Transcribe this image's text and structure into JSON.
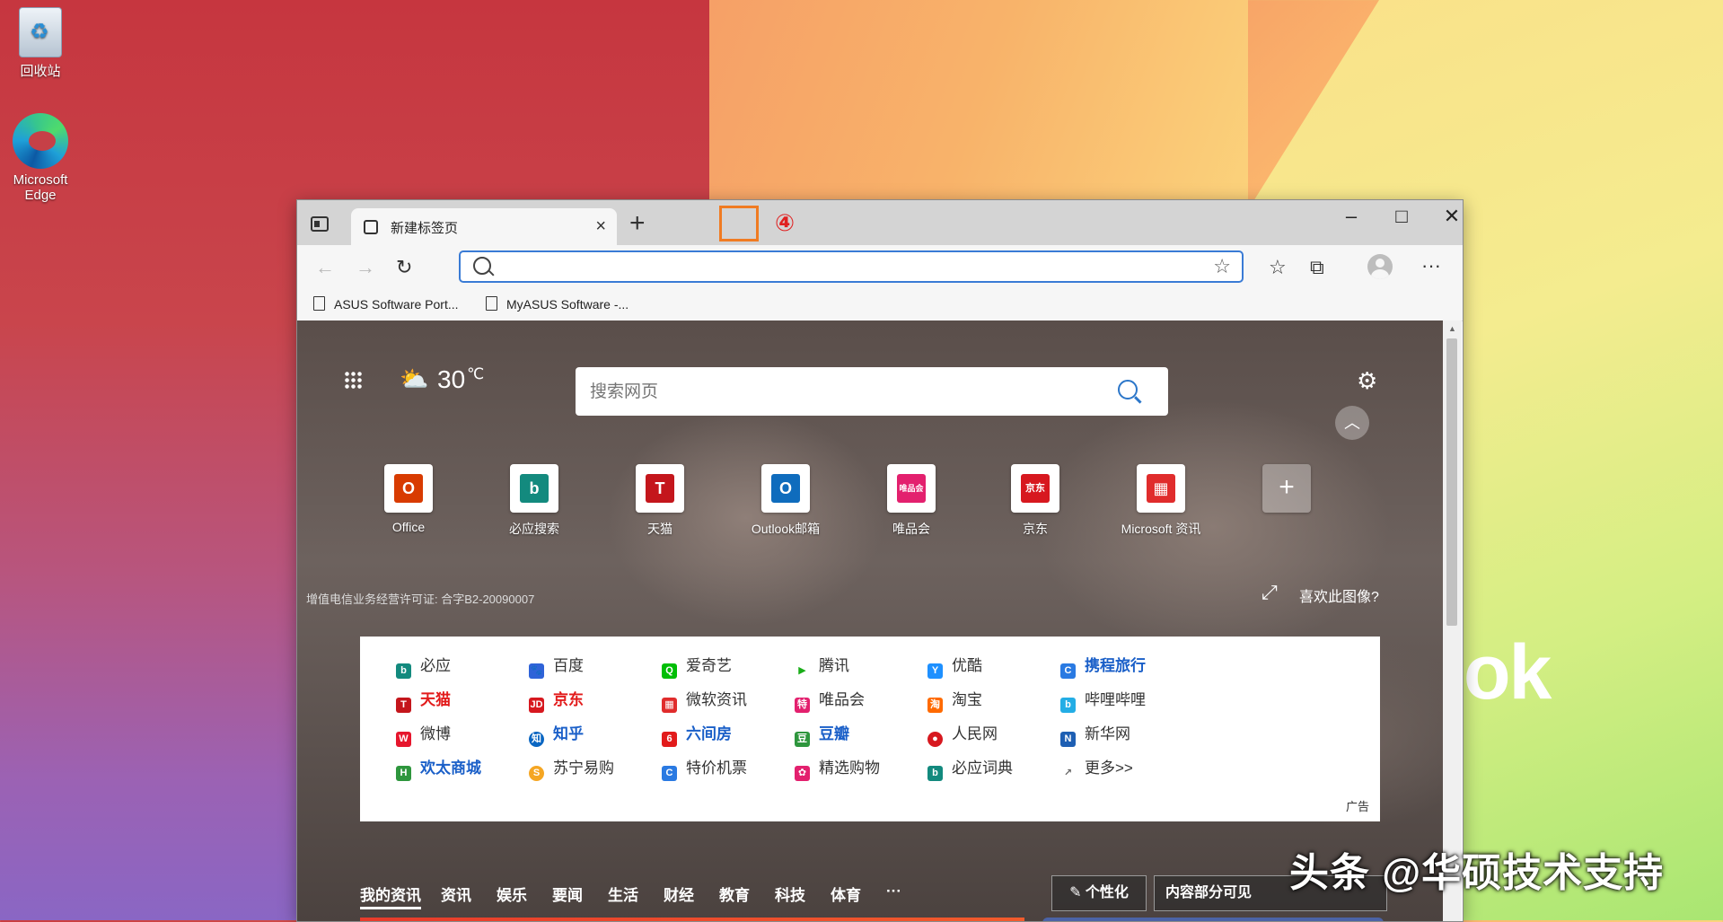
{
  "desktop": {
    "icons": [
      {
        "label": "回收站"
      },
      {
        "label": "Microsoft Edge"
      }
    ],
    "wallpaper_text": "ok"
  },
  "browser": {
    "tab": {
      "title": "新建标签页",
      "close": "×"
    },
    "new_tab": "+",
    "annotation_number": "④",
    "window_controls": {
      "minimize": "–",
      "maximize": "□",
      "close": "✕"
    },
    "toolbar": {
      "back": "←",
      "forward": "→",
      "refresh": "↻",
      "address_value": "",
      "favorites": "☆",
      "collections": "⧉",
      "more": "···",
      "add_fav": "☆"
    },
    "favorites_bar": [
      {
        "label": "ASUS Software Port..."
      },
      {
        "label": "MyASUS Software -..."
      }
    ]
  },
  "newtab": {
    "weather": {
      "icon": "⛅",
      "temp": "30",
      "unit": "℃"
    },
    "search": {
      "placeholder": "搜索网页"
    },
    "settings": "⚙",
    "collapse": "︿",
    "tiles": [
      {
        "label": "Office",
        "glyph": "O",
        "color": "#d83b01"
      },
      {
        "label": "必应搜索",
        "glyph": "b",
        "color": "#138a7e"
      },
      {
        "label": "天猫",
        "glyph": "T",
        "color": "#c4161c"
      },
      {
        "label": "Outlook邮箱",
        "glyph": "O",
        "color": "#0f6cbd"
      },
      {
        "label": "唯品会",
        "glyph": "唯品会",
        "color": "#e3206e"
      },
      {
        "label": "京东",
        "glyph": "京东",
        "color": "#d7181f"
      },
      {
        "label": "Microsoft 资讯",
        "glyph": "▦",
        "color": "#e02c2c"
      },
      {
        "label": "",
        "glyph": "+",
        "color": ""
      }
    ],
    "license": "增值电信业务经营许可证: 合字B2-20090007",
    "expand": "⤢",
    "like_image": "喜欢此图像?",
    "links": [
      [
        "必应",
        "百度",
        "爱奇艺",
        "腾讯",
        "优酷",
        "携程旅行"
      ],
      [
        "天猫",
        "京东",
        "微软资讯",
        "唯品会",
        "淘宝",
        "哔哩哔哩"
      ],
      [
        "微博",
        "知乎",
        "六间房",
        "豆瓣",
        "人民网",
        "新华网"
      ],
      [
        "欢太商城",
        "苏宁易购",
        "特价机票",
        "精选购物",
        "必应词典",
        "更多>>"
      ]
    ],
    "ad_label": "广告",
    "news_tabs": [
      "我的资讯",
      "资讯",
      "娱乐",
      "要闻",
      "生活",
      "财经",
      "教育",
      "科技",
      "体育",
      "···"
    ],
    "personalize": "个性化",
    "visibility": "内容部分可见"
  },
  "watermark": "头条 @华硕技术支持"
}
